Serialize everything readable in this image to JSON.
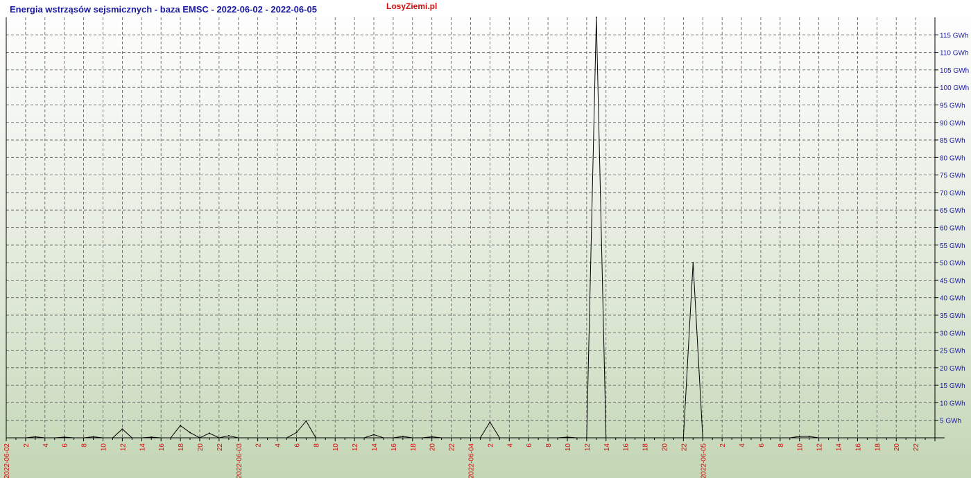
{
  "header": {
    "title": "Energia wstrząsów sejsmicznych - baza EMSC - 2022-06-02 - 2022-06-05",
    "brand": "LosyZiemi.pl"
  },
  "colors": {
    "title": "#1a1aa0",
    "brand": "#d01010",
    "y_tick_text": "#1a1aa0",
    "x_tick_text": "#d01010",
    "line": "#000000",
    "grid": "#555555"
  },
  "chart_data": {
    "type": "line",
    "title": "Energia wstrząsów sejsmicznych - baza EMSC - 2022-06-02 - 2022-06-05",
    "x_unit": "hour",
    "xlim": [
      "2022-06-02 00:00",
      "2022-06-05 23:00"
    ],
    "ylim": [
      0,
      120
    ],
    "y_unit": "GWh",
    "y_tick_values": [
      5,
      10,
      15,
      20,
      25,
      30,
      35,
      40,
      45,
      50,
      55,
      60,
      65,
      70,
      75,
      80,
      85,
      90,
      95,
      100,
      105,
      110,
      115
    ],
    "y_tick_labels": [
      "5 GWh",
      "10 GWh",
      "15 GWh",
      "20 GWh",
      "25 GWh",
      "30 GWh",
      "35 GWh",
      "40 GWh",
      "45 GWh",
      "50 GWh",
      "55 GWh",
      "60 GWh",
      "65 GWh",
      "70 GWh",
      "75 GWh",
      "80 GWh",
      "85 GWh",
      "90 GWh",
      "95 GWh",
      "100 GWh",
      "105 GWh",
      "110 GWh",
      "115 GWh"
    ],
    "x_tick_labels": [
      "2022-06-02",
      "2",
      "4",
      "6",
      "8",
      "10",
      "12",
      "14",
      "16",
      "18",
      "20",
      "22",
      "2022-06-03",
      "2",
      "4",
      "6",
      "8",
      "10",
      "12",
      "14",
      "16",
      "18",
      "20",
      "22",
      "2022-06-04",
      "2",
      "4",
      "6",
      "8",
      "10",
      "12",
      "14",
      "16",
      "18",
      "20",
      "22",
      "2022-06-05",
      "2",
      "4",
      "6",
      "8",
      "10",
      "12",
      "14",
      "16",
      "18",
      "20",
      "22"
    ],
    "grid": true,
    "series": [
      {
        "values": [
          0,
          0,
          0,
          0.3,
          0,
          0,
          0.2,
          0,
          0,
          0.3,
          0,
          0,
          2.5,
          0,
          0,
          0.2,
          0,
          0,
          3.5,
          1.5,
          0,
          1.3,
          0,
          0.6,
          0,
          0,
          0,
          0,
          0,
          0,
          1.5,
          4.8,
          0,
          0,
          0,
          0,
          0,
          0,
          0.9,
          0,
          0,
          0.4,
          0,
          0,
          0.3,
          0,
          0,
          0,
          0,
          0,
          4.5,
          0,
          0,
          0,
          0,
          0,
          0,
          0,
          0.2,
          0,
          0,
          120,
          0,
          0,
          0,
          0,
          0,
          0,
          0,
          0,
          0,
          50,
          0,
          0,
          0,
          0,
          0,
          0,
          0,
          0,
          0,
          0,
          0.4,
          0.4,
          0,
          0,
          0,
          0,
          0,
          0,
          0,
          0,
          0,
          0,
          0,
          0,
          0,
          0
        ]
      }
    ]
  }
}
